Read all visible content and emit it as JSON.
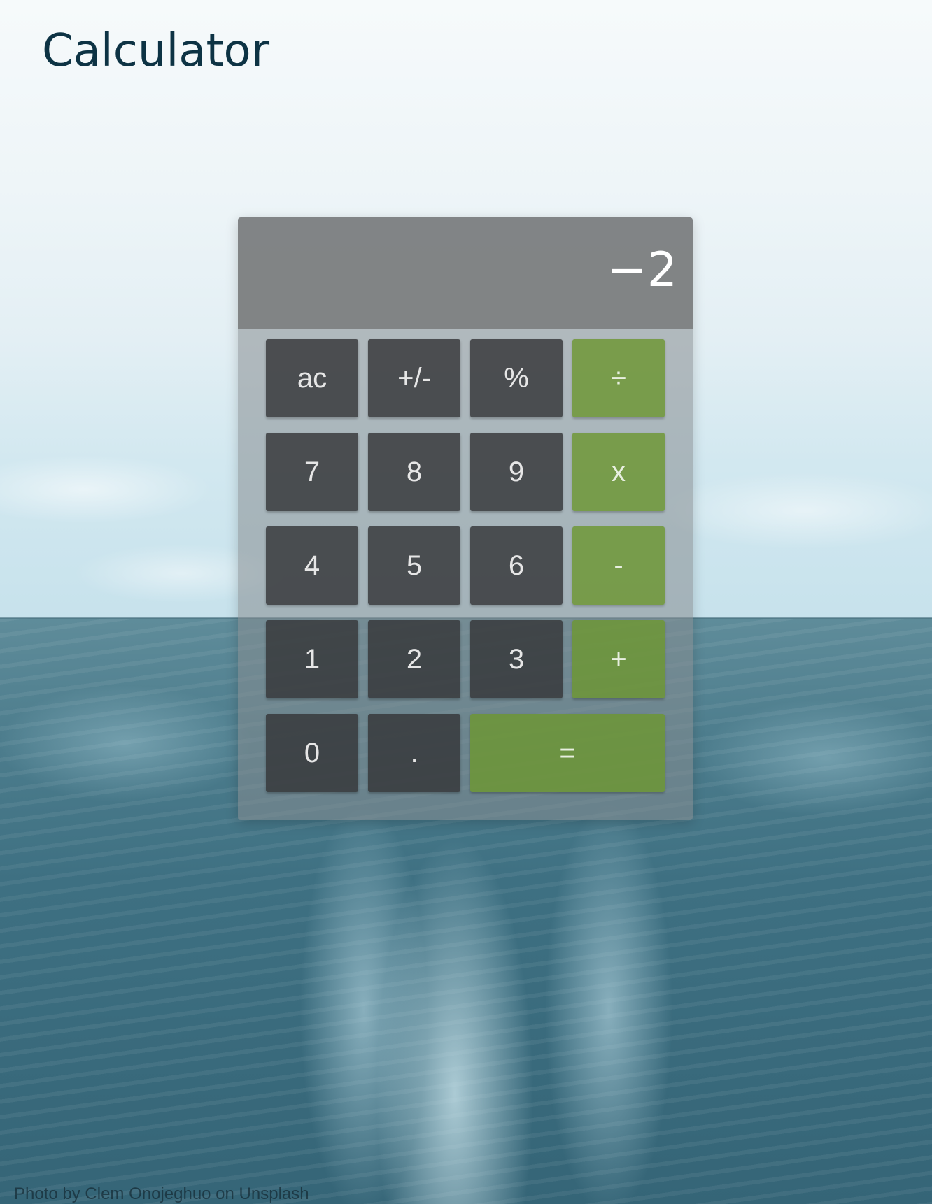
{
  "page": {
    "title": "Calculator",
    "photo_credit": "Photo by Clem Onojeghuo on Unsplash"
  },
  "calculator": {
    "display_value": "−2",
    "keys": {
      "clear": "ac",
      "sign": "+/-",
      "percent": "%",
      "divide": "÷",
      "seven": "7",
      "eight": "8",
      "nine": "9",
      "multiply": "x",
      "four": "4",
      "five": "5",
      "six": "6",
      "subtract": "-",
      "one": "1",
      "two": "2",
      "three": "3",
      "add": "+",
      "zero": "0",
      "decimal": ".",
      "equals": "="
    }
  },
  "colors": {
    "operator_keys": "#6c9632",
    "number_keys": "#343638",
    "display_background": "#767879",
    "title_text": "#0d3344"
  },
  "background": {
    "subject": "ocean-wake-photo"
  }
}
